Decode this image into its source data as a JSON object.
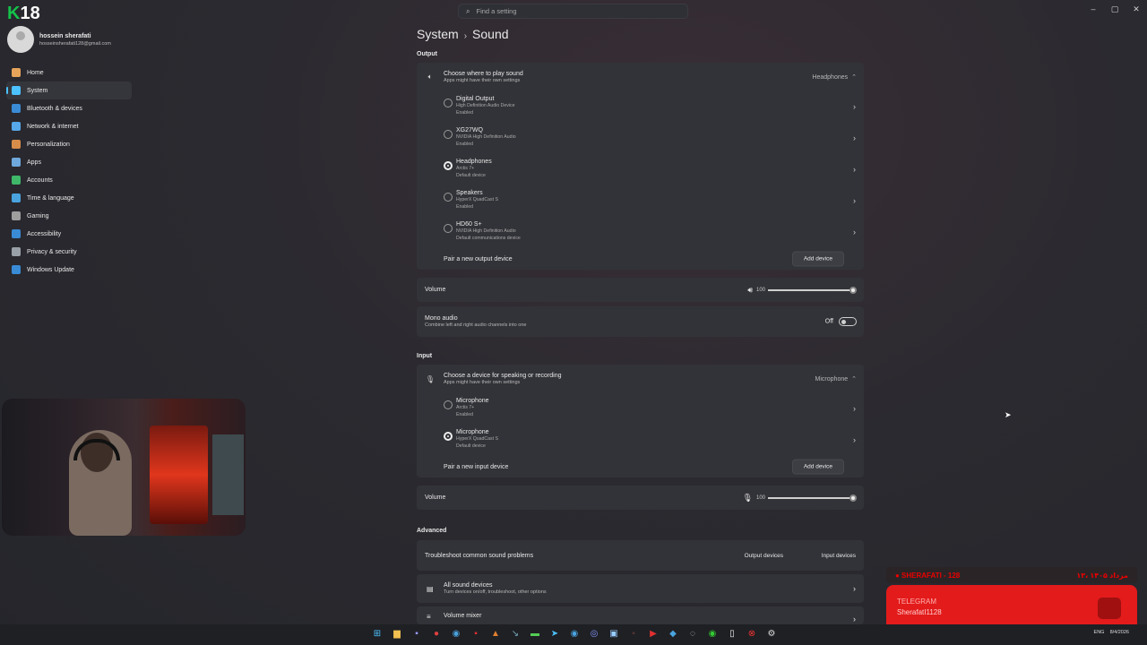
{
  "logo": {
    "k": "K",
    "num": "18"
  },
  "window_controls": [
    "–",
    "▢",
    "✕"
  ],
  "search": {
    "placeholder": "Find a setting",
    "icon": "search-icon"
  },
  "user": {
    "name": "hossein sherafati",
    "email": "hosseinsherafati128@gmail.com"
  },
  "nav": [
    {
      "label": "Home",
      "icon": "home-icon",
      "color": "#e6a45b"
    },
    {
      "label": "System",
      "icon": "system-icon",
      "color": "#4cc2ff"
    },
    {
      "label": "Bluetooth & devices",
      "icon": "bluetooth-icon",
      "color": "#3a8bd6"
    },
    {
      "label": "Network & internet",
      "icon": "wifi-icon",
      "color": "#56a8e8"
    },
    {
      "label": "Personalization",
      "icon": "brush-icon",
      "color": "#d88c4a"
    },
    {
      "label": "Apps",
      "icon": "apps-icon",
      "color": "#6fa8dc"
    },
    {
      "label": "Accounts",
      "icon": "accounts-icon",
      "color": "#3fb86a"
    },
    {
      "label": "Time & language",
      "icon": "globe-icon",
      "color": "#4aa3df"
    },
    {
      "label": "Gaming",
      "icon": "gaming-icon",
      "color": "#9e9e9e"
    },
    {
      "label": "Accessibility",
      "icon": "accessibility-icon",
      "color": "#3a8bd6"
    },
    {
      "label": "Privacy & security",
      "icon": "shield-icon",
      "color": "#9aa0a8"
    },
    {
      "label": "Windows Update",
      "icon": "update-icon",
      "color": "#3a8bd6"
    }
  ],
  "breadcrumb": {
    "parent": "System",
    "current": "Sound"
  },
  "output": {
    "section": "Output",
    "title": "Choose where to play sound",
    "subtitle": "Apps might have their own settings",
    "selected": "Headphones",
    "devices": [
      {
        "name": "Digital Output",
        "line1": "High Definition Audio Device",
        "line2": "Enabled",
        "selected": false
      },
      {
        "name": "XG27WQ",
        "line1": "NVIDIA High Definition Audio",
        "line2": "Enabled",
        "selected": false
      },
      {
        "name": "Headphones",
        "line1": "Arctis 7+",
        "line2": "Default device",
        "selected": true
      },
      {
        "name": "Speakers",
        "line1": "HyperX QuadCast S",
        "line2": "Enabled",
        "selected": false
      },
      {
        "name": "HD60 S+",
        "line1": "NVIDIA High Definition Audio",
        "line2": "Default communications device",
        "selected": false
      }
    ],
    "pair_label": "Pair a new output device",
    "add_label": "Add device",
    "volume_label": "Volume",
    "volume_value": "100",
    "mono_label": "Mono audio",
    "mono_sub": "Combine left and right audio channels into one",
    "mono_state": "Off"
  },
  "input": {
    "section": "Input",
    "title": "Choose a device for speaking or recording",
    "subtitle": "Apps might have their own settings",
    "selected": "Microphone",
    "devices": [
      {
        "name": "Microphone",
        "line1": "Arctis 7+",
        "line2": "Enabled",
        "selected": false
      },
      {
        "name": "Microphone",
        "line1": "HyperX QuadCast S",
        "line2": "Default device",
        "selected": true
      }
    ],
    "pair_label": "Pair a new input device",
    "add_label": "Add device",
    "volume_label": "Volume",
    "volume_value": "100"
  },
  "advanced": {
    "section": "Advanced",
    "troubleshoot": "Troubleshoot common sound problems",
    "output_devices": "Output devices",
    "input_devices": "Input devices",
    "all_devices": "All sound devices",
    "all_devices_sub": "Turn devices on/off, troubleshoot, other options",
    "mixer": "Volume mixer"
  },
  "tray": {
    "lang": "ENG",
    "date": "8/4/2026"
  },
  "overlay": {
    "top_left": "● SHERAFATI - 128",
    "top_right": "۱۳، مرداد ۱۴۰۵",
    "line1": "TELEGRAM",
    "line2": "SherafatI1128"
  }
}
